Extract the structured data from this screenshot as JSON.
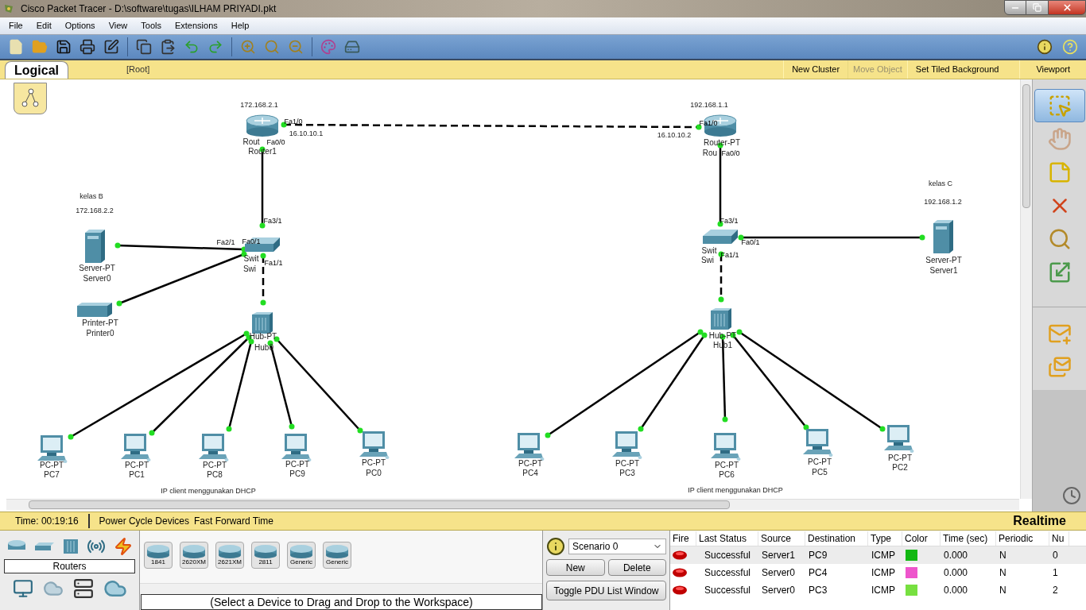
{
  "window": {
    "title": "Cisco Packet Tracer - D:\\software\\tugas\\ILHAM PRIYADI.pkt"
  },
  "menu": [
    "File",
    "Edit",
    "Options",
    "View",
    "Tools",
    "Extensions",
    "Help"
  ],
  "workspace_bar": {
    "tab": "Logical",
    "path": "[Root]",
    "actions": [
      {
        "label": "New Cluster",
        "disabled": false
      },
      {
        "label": "Move Object",
        "disabled": true
      },
      {
        "label": "Set Tiled Background",
        "disabled": false
      },
      {
        "label": "Viewport",
        "disabled": false
      }
    ]
  },
  "canvas": {
    "devices": [
      {
        "kind": "router",
        "model": "Rout",
        "name": "Router1"
      },
      {
        "kind": "router",
        "model": "Router-PT",
        "name": "Rou"
      },
      {
        "kind": "switch",
        "model": "Swit",
        "name": "Swi"
      },
      {
        "kind": "switch",
        "model": "Swit",
        "name": "Swi"
      },
      {
        "kind": "server",
        "model": "Server-PT",
        "name": "Server0"
      },
      {
        "kind": "printer",
        "model": "Printer-PT",
        "name": "Printer0"
      },
      {
        "kind": "server",
        "model": "Server-PT",
        "name": "Server1"
      },
      {
        "kind": "hub",
        "model": "Hub-PT",
        "name": "Hub0"
      },
      {
        "kind": "hub",
        "model": "Hub-PT",
        "name": "Hub1"
      },
      {
        "kind": "pc",
        "model": "PC-PT",
        "name": "PC7"
      },
      {
        "kind": "pc",
        "model": "PC-PT",
        "name": "PC1"
      },
      {
        "kind": "pc",
        "model": "PC-PT",
        "name": "PC8"
      },
      {
        "kind": "pc",
        "model": "PC-PT",
        "name": "PC9"
      },
      {
        "kind": "pc",
        "model": "PC-PT",
        "name": "PC0"
      },
      {
        "kind": "pc",
        "model": "PC-PT",
        "name": "PC4"
      },
      {
        "kind": "pc",
        "model": "PC-PT",
        "name": "PC3"
      },
      {
        "kind": "pc",
        "model": "PC-PT",
        "name": "PC6"
      },
      {
        "kind": "pc",
        "model": "PC-PT",
        "name": "PC5"
      },
      {
        "kind": "pc",
        "model": "PC-PT",
        "name": "PC2"
      }
    ],
    "links": [
      {
        "kind": "crossover"
      },
      {
        "kind": "straight"
      },
      {
        "kind": "straight"
      },
      {
        "kind": "straight"
      },
      {
        "kind": "crossover"
      },
      {
        "kind": "straight"
      },
      {
        "kind": "straight"
      },
      {
        "kind": "crossover"
      },
      {
        "kind": "straight"
      },
      {
        "kind": "straight"
      },
      {
        "kind": "straight"
      },
      {
        "kind": "straight"
      },
      {
        "kind": "straight"
      },
      {
        "kind": "straight"
      },
      {
        "kind": "straight"
      },
      {
        "kind": "straight"
      },
      {
        "kind": "straight"
      },
      {
        "kind": "straight"
      }
    ],
    "ports": [
      "Fa1/0",
      "Fa0/0",
      "Fa3/1",
      "Fa2/1",
      "Fa0/1",
      "Fa1/1",
      "Fa1/0",
      "Fa0/0",
      "Fa3/1",
      "Fa0/1",
      "Fa1/1"
    ],
    "notes": [
      "172.168.2.1",
      "16.10.10.1",
      "192.168.1.1",
      "16.10.10.2",
      "kelas B",
      "172.168.2.2",
      "kelas C",
      "192.168.1.2",
      "IP client menggunakan DHCP",
      "IP client menggunakan DHCP"
    ]
  },
  "tools": [
    {
      "kind": "select",
      "selected": true
    },
    {
      "kind": "move",
      "selected": false
    },
    {
      "kind": "note",
      "selected": false
    },
    {
      "kind": "delete",
      "selected": false
    },
    {
      "kind": "inspect",
      "selected": false
    },
    {
      "kind": "resize",
      "selected": false
    },
    {
      "kind": "simple-pdu",
      "selected": false
    },
    {
      "kind": "complex-pdu",
      "selected": false
    }
  ],
  "status_bar": {
    "time": "Time: 00:19:16",
    "actions": [
      "Power Cycle Devices",
      "Fast Forward Time"
    ],
    "mode": "Realtime"
  },
  "device_panel": {
    "category": "Routers",
    "models": [
      "1841",
      "2620XM",
      "2621XM",
      "2811",
      "Generic",
      "Generic"
    ],
    "hint": "(Select a Device to Drag and Drop to the Workspace)"
  },
  "scenario": {
    "value": "Scenario 0",
    "buttons": [
      "New",
      "Delete"
    ],
    "toggle": "Toggle PDU List Window"
  },
  "pdu_table": {
    "columns": [
      "Fire",
      "Last Status",
      "Source",
      "Destination",
      "Type",
      "Color",
      "Time (sec)",
      "Periodic",
      "Nu"
    ],
    "rows": [
      {
        "selected": true,
        "last_status": "Successful",
        "source": "Server1",
        "destination": "PC9",
        "type": "ICMP",
        "color": "#12b812",
        "time": "0.000",
        "periodic": "N",
        "num": "0"
      },
      {
        "selected": false,
        "last_status": "Successful",
        "source": "Server0",
        "destination": "PC4",
        "type": "ICMP",
        "color": "#ee55cc",
        "time": "0.000",
        "periodic": "N",
        "num": "1"
      },
      {
        "selected": false,
        "last_status": "Successful",
        "source": "Server0",
        "destination": "PC3",
        "type": "ICMP",
        "color": "#77e040",
        "time": "0.000",
        "periodic": "N",
        "num": "2"
      }
    ]
  }
}
